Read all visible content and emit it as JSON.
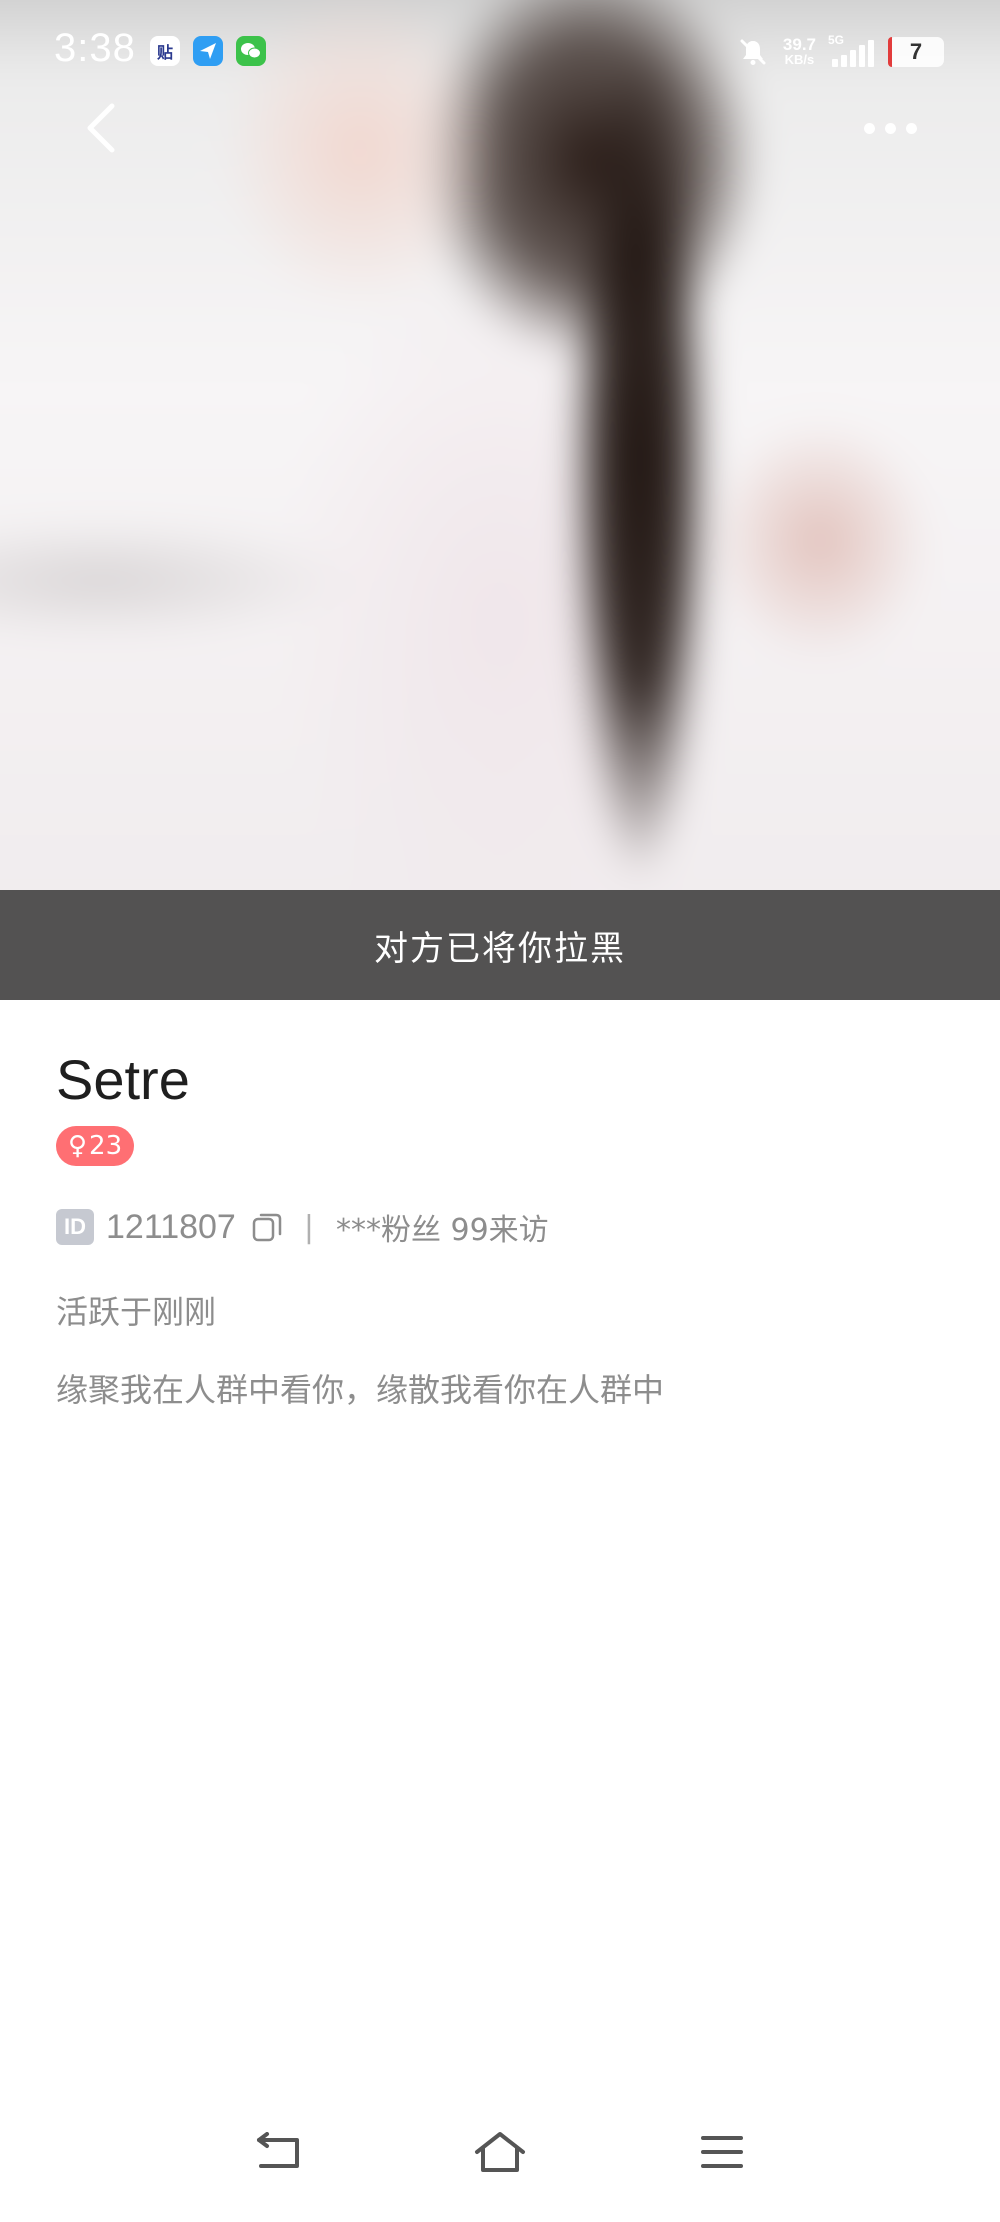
{
  "status_bar": {
    "time": "3:38",
    "app_tie_label": "贴",
    "net_speed_value": "39.7",
    "net_speed_unit": "KB/s",
    "network_type": "5G",
    "battery_level": "7",
    "status_icons": [
      "tie-app-icon",
      "send-app-icon",
      "wechat-app-icon",
      "mute-bell-icon",
      "signal-icon",
      "battery-icon"
    ]
  },
  "nav": {
    "back_icon": "chevron-left-icon",
    "more_icon": "more-dots-icon"
  },
  "cover": {
    "blocked_message": "对方已将你拉黑"
  },
  "profile": {
    "name": "Setre",
    "gender_symbol": "♀",
    "age": "23",
    "id_badge": "ID",
    "id_value": "1211807",
    "separator": "|",
    "stats": "***粉丝 99来访",
    "active_status": "活跃于刚刚",
    "bio": "缘聚我在人群中看你，缘散我看你在人群中"
  },
  "colors": {
    "gender_badge": "#ff6f73",
    "banner_bg": "#262626",
    "secondary_text": "#8d8d8d",
    "title_text": "#1f1f1f"
  },
  "system_nav": {
    "icons": [
      "system-back-icon",
      "system-home-icon",
      "system-menu-icon"
    ]
  }
}
